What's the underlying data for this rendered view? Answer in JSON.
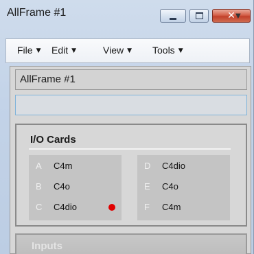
{
  "window": {
    "title": "AllFrame #1",
    "close_glyph": "✕"
  },
  "menubar": {
    "items": [
      {
        "label": "File"
      },
      {
        "label": "Edit"
      },
      {
        "label": "View"
      },
      {
        "label": "Tools"
      }
    ],
    "caret": "▼",
    "overflow_glyph": "▼"
  },
  "frame_name_field": {
    "value": "AllFrame #1"
  },
  "secondary_field": {
    "value": ""
  },
  "io_cards": {
    "title": "I/O Cards",
    "left_group": [
      {
        "slot": "A",
        "card": "C4m"
      },
      {
        "slot": "B",
        "card": "C4o"
      },
      {
        "slot": "C",
        "card": "C4dio",
        "status": "error"
      }
    ],
    "right_group": [
      {
        "slot": "D",
        "card": "C4dio"
      },
      {
        "slot": "E",
        "card": "C4o"
      },
      {
        "slot": "F",
        "card": "C4m"
      }
    ],
    "status_color": "#e00000"
  },
  "inputs_panel": {
    "title": "Inputs"
  }
}
